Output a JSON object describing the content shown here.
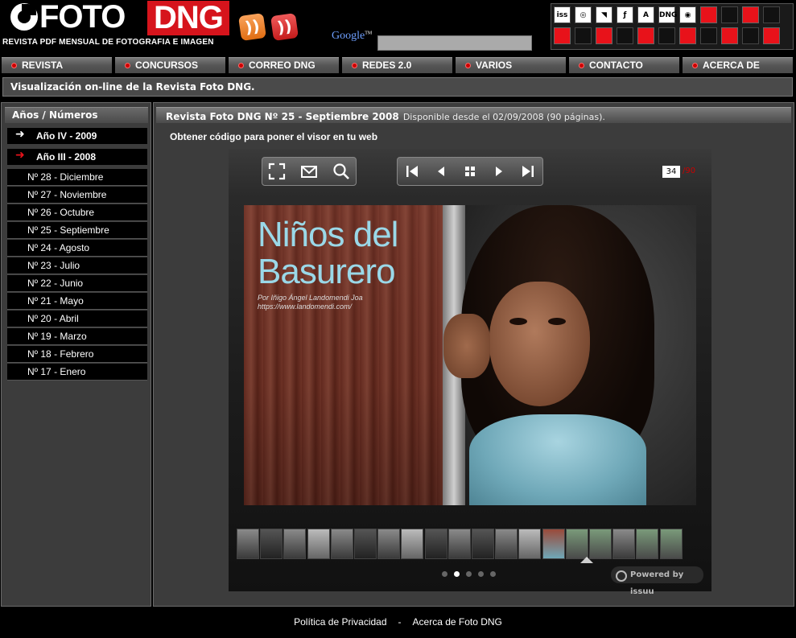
{
  "header": {
    "logo_foto": "FOTO",
    "logo_dng": "DNG",
    "logo_subtitle": "REVISTA PDF MENSUAL DE FOTOGRAFIA E IMAGEN",
    "google_label": "Google",
    "search_placeholder": "",
    "icon_grid": [
      {
        "type": "icon",
        "name": "issuu-icon",
        "text": "iss"
      },
      {
        "type": "icon",
        "name": "target-icon",
        "text": "◎"
      },
      {
        "type": "icon",
        "name": "red-stripe-icon",
        "text": "◥"
      },
      {
        "type": "icon",
        "name": "script-icon",
        "text": "ƒ"
      },
      {
        "type": "icon",
        "name": "letter-a-icon",
        "text": "A"
      },
      {
        "type": "icon",
        "name": "fotodng-icon",
        "text": "DNG"
      },
      {
        "type": "icon",
        "name": "fotodng-logo-icon",
        "text": "◉"
      },
      {
        "type": "red"
      },
      {
        "type": "empty"
      },
      {
        "type": "red"
      },
      {
        "type": "empty"
      },
      {
        "type": "red"
      },
      {
        "type": "empty"
      },
      {
        "type": "red"
      },
      {
        "type": "empty"
      },
      {
        "type": "red"
      },
      {
        "type": "empty"
      },
      {
        "type": "red"
      },
      {
        "type": "empty"
      },
      {
        "type": "red"
      },
      {
        "type": "empty"
      },
      {
        "type": "red"
      }
    ]
  },
  "nav": [
    "REVISTA",
    "CONCURSOS",
    "CORREO DNG",
    "REDES 2.0",
    "VARIOS",
    "CONTACTO",
    "ACERCA DE"
  ],
  "banner": "Visualización on-line de la Revista Foto DNG.",
  "sidebar": {
    "title": "Años / Números",
    "years": [
      {
        "label": "Año IV - 2009",
        "arrow": "➜",
        "color": "#ffffff"
      },
      {
        "label": "Año III - 2008",
        "arrow": "➜",
        "color": "#e8121a"
      }
    ],
    "issues": [
      "Nº 28 - Diciembre",
      "Nº 27 - Noviembre",
      "Nº 26 - Octubre",
      "Nº 25 - Septiembre",
      "Nº 24 - Agosto",
      "Nº 23 - Julio",
      "Nº 22 - Junio",
      "Nº 21 - Mayo",
      "Nº 20 - Abril",
      "Nº 19 - Marzo",
      "Nº 18 - Febrero",
      "Nº 17 - Enero"
    ]
  },
  "main": {
    "title": "Revista Foto DNG Nº 25 - Septiembre 2008",
    "available": "Disponible desde el 02/09/2008 (90 páginas).",
    "code_link": "Obtener código para poner el visor en tu web"
  },
  "viewer": {
    "page_current": "34",
    "page_total": "/90",
    "cover_title_line1": "Niños del",
    "cover_title_line2": "Basurero",
    "cover_credit_line1": "Por Iñigo Ángel Landomendi Joa",
    "cover_credit_line2": "https://www.landomendi.com/",
    "powered_by": "Powered by issuu",
    "thumb_count": 19,
    "active_dot": 1,
    "dot_count": 5
  },
  "footer": {
    "privacy": "Política de Privacidad",
    "separator": "-",
    "about": "Acerca de Foto DNG"
  }
}
